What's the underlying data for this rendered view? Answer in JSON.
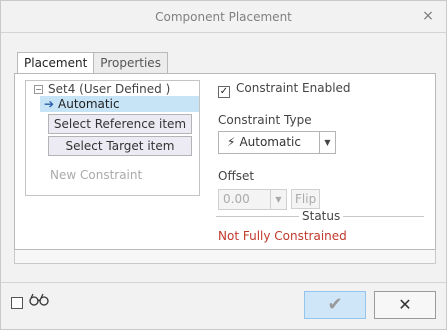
{
  "window": {
    "title": "Component Placement",
    "close_icon": "×"
  },
  "tabs": [
    {
      "label": "Placement",
      "active": true
    },
    {
      "label": "Properties",
      "active": false
    }
  ],
  "tree": {
    "root_label": "Set4 (User Defined )",
    "root_toggle": "−",
    "selected_arrow": "➔",
    "selected_label": "Automatic",
    "select_reference_label": "Select Reference item",
    "select_target_label": "Select Target item",
    "new_constraint_label": "New Constraint"
  },
  "constraint": {
    "enabled_check": "✓",
    "enabled_label": "Constraint Enabled",
    "type_label": "Constraint Type",
    "type_icon": "⚡",
    "type_value": "Automatic",
    "dropdown_arrow": "▼"
  },
  "offset": {
    "label": "Offset",
    "value": "0.00",
    "dropdown_arrow": "▼",
    "flip_label": "Flip"
  },
  "status": {
    "label": "Status",
    "value": "Not Fully Constrained",
    "color": "#c0392b"
  },
  "footer": {
    "glasses_icon": "ෆ",
    "ok_icon": "✔",
    "cancel_icon": "✕"
  }
}
